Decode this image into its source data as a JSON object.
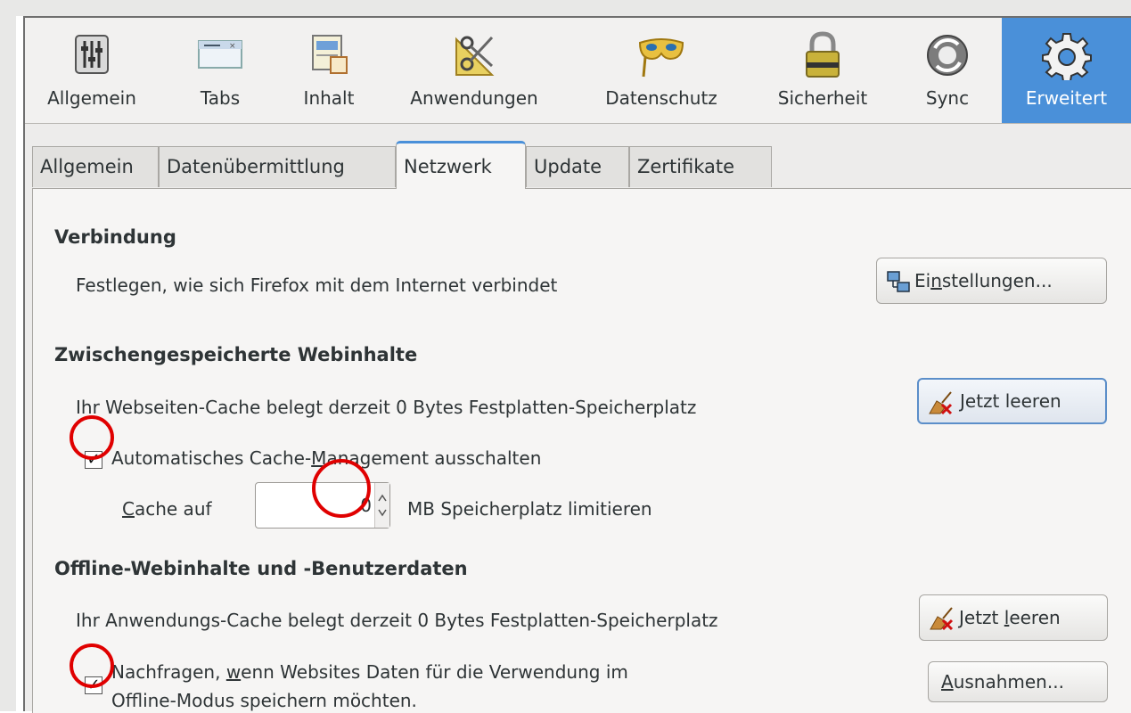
{
  "toolbar": {
    "items": [
      {
        "label": "Allgemein",
        "icon": "general-sliders-icon"
      },
      {
        "label": "Tabs",
        "icon": "tabs-icon"
      },
      {
        "label": "Inhalt",
        "icon": "content-icon"
      },
      {
        "label": "Anwendungen",
        "icon": "applications-icon"
      },
      {
        "label": "Datenschutz",
        "icon": "privacy-mask-icon"
      },
      {
        "label": "Sicherheit",
        "icon": "security-lock-icon"
      },
      {
        "label": "Sync",
        "icon": "sync-icon"
      },
      {
        "label": "Erweitert",
        "icon": "advanced-gear-icon"
      }
    ],
    "active": "Erweitert"
  },
  "tabs": {
    "items": [
      "Allgemein",
      "Datenübermittlung",
      "Netzwerk",
      "Update",
      "Zertifikate"
    ],
    "active": "Netzwerk"
  },
  "connection": {
    "heading": "Verbindung",
    "description": "Festlegen, wie sich Firefox mit dem Internet verbindet",
    "settings_button": {
      "pre": "Ei",
      "mnemonic": "n",
      "post": "stellungen..."
    }
  },
  "cache": {
    "heading": "Zwischengespeicherte Webinhalte",
    "description": "Ihr Webseiten-Cache belegt derzeit 0 Bytes Festplatten-Speicherplatz",
    "clear_button": {
      "mnemonic": "J",
      "post": "etzt leeren"
    },
    "override_checkbox": {
      "pre": "Automatisches Cache-",
      "mnemonic": "M",
      "post": "anagement ausschalten",
      "checked": true
    },
    "limit": {
      "label_mnemonic": "C",
      "label_post": "ache auf",
      "value": "0",
      "suffix": "MB Speicherplatz limitieren"
    }
  },
  "offline": {
    "heading": "Offline-Webinhalte und -Benutzerdaten",
    "description": "Ihr Anwendungs-Cache belegt derzeit 0 Bytes Festplatten-Speicherplatz",
    "clear_button": {
      "pre": "Jetzt ",
      "mnemonic": "l",
      "post": "eeren"
    },
    "ask_checkbox": {
      "line1_pre": "Nachfragen, ",
      "line1_mnemonic": "w",
      "line1_post": "enn Websites Daten für die Verwendung im",
      "line2": "Offline-Modus speichern möchten.",
      "checked": true
    },
    "exceptions_button": {
      "mnemonic": "A",
      "post": "usnahmen..."
    }
  },
  "annotation_color": "#e00000",
  "accent_color": "#4a90d9"
}
